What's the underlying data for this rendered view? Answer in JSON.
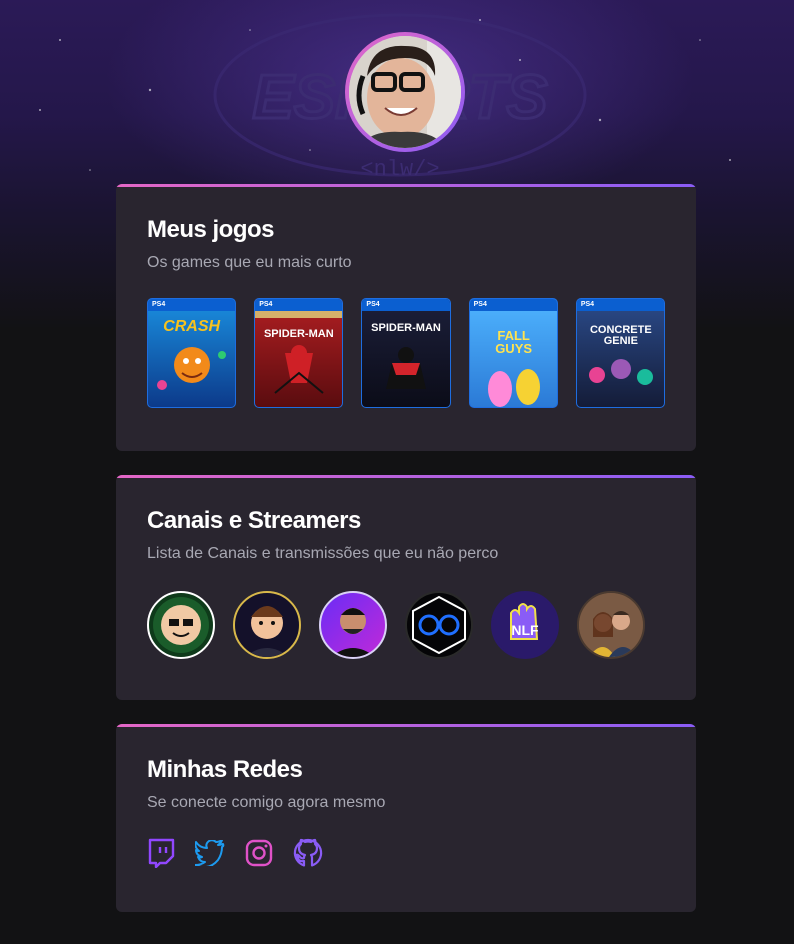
{
  "profile": {
    "avatar_alt": ""
  },
  "sections": {
    "games": {
      "title": "Meus jogos",
      "subtitle": "Os games que eu mais curto",
      "items": [
        {
          "name": "CRASH",
          "platform": "PS4"
        },
        {
          "name": "SPIDER-MAN",
          "platform": "PS4"
        },
        {
          "name": "SPIDER-MAN",
          "platform": "PS4"
        },
        {
          "name": "FALL GUYS",
          "platform": "PS4"
        },
        {
          "name": "CONCRETE GENIE",
          "platform": "PS4"
        }
      ]
    },
    "channels": {
      "title": "Canais e Streamers",
      "subtitle": "Lista de Canais e transmissões que eu não perco",
      "items": [
        "casimiro",
        "streamer-2",
        "streamer-3",
        "glasses-logo",
        "nlf-logo",
        "couple"
      ]
    },
    "socials": {
      "title": "Minhas Redes",
      "subtitle": "Se conecte comigo agora mesmo",
      "items": [
        {
          "name": "twitch-icon",
          "color": "#9147ff"
        },
        {
          "name": "twitter-icon",
          "color": "#1d9bf0"
        },
        {
          "name": "instagram-icon",
          "color": "#e052c8"
        },
        {
          "name": "github-icon",
          "color": "#8a5cf6"
        }
      ]
    }
  },
  "colors": {
    "accent_start": "#e467c6",
    "accent_end": "#8a5cf6",
    "card_bg": "#29252f",
    "page_bg": "#121214"
  }
}
